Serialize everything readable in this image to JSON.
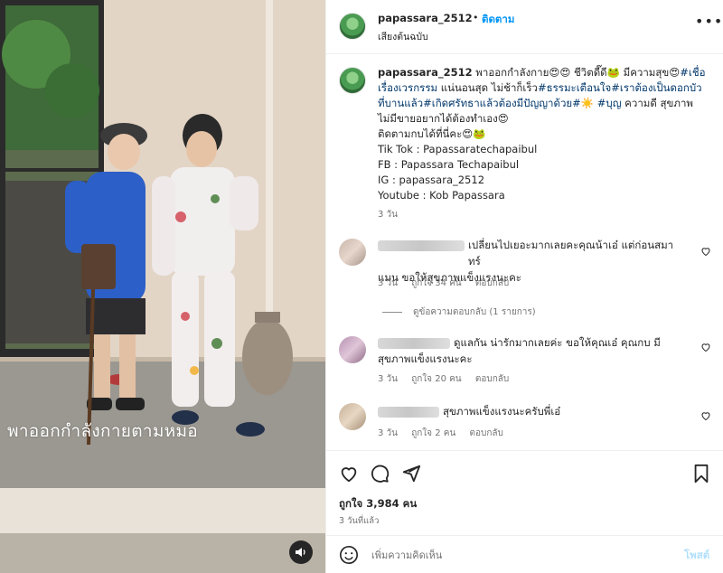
{
  "post": {
    "username": "papassara_2512",
    "separator": "•",
    "follow_label": "ติดตาม",
    "audio_label": "เสียงต้นฉบับ",
    "more_label": "•••",
    "video_overlay_text": "พาออกกำลังกายตามหมอ"
  },
  "caption": {
    "username": "papassara_2512",
    "line1_text": " พาออกกำลังกาย😍😍 ชีวิตดี๊ดี🐸 มีความสุข😍",
    "line1_tag": "#เชื่อ",
    "line2_tag": "เรื่องเวรกรรม",
    "line2_text": " แน่นอนสุด ไม่ช้าก็เร็ว",
    "line2_tag2": "#ธรรมะเตือนใจ",
    "line2_tag3": "#เราต้องเป็นดอกบัว",
    "line3_tag": "ที่บานแล้ว",
    "line3_tag2": "#เกิดศรัทธาแล้วต้องมีปัญญาด้วย",
    "line3_text": "#☀️ ",
    "line3_tag3": "#บุญ",
    "line3_text2": " ความดี สุขภาพ",
    "line4": "ไม่มีขายอยากได้ต้องทำเอง😍",
    "line5": "ติดตามกบได้ที่นี่คะ😍🐸",
    "line6": "Tik Tok : Papassaratechapaibul",
    "line7": "FB : Papassara Techapaibul",
    "line8": "IG : papassara_2512",
    "line9": "Youtube : Kob Papassara",
    "time": "3 วัน"
  },
  "comments": [
    {
      "line1": "เปลี่ยนไปเยอะมากเลยคะคุณน้าเอ๋ แต่ก่อนสมาทร์",
      "line2": "แมน ขอให้สุขภาพแข็งแรงนะคะ",
      "time": "3 วัน",
      "likes": "ถูกใจ 34 คน",
      "reply": "ตอบกลับ"
    },
    {
      "line1": "ดูแลกัน น่ารักมากเลยค่ะ ขอให้คุณเอ๋ คุณกบ มี",
      "line2": "สุขภาพแข็งแรงนะคะ",
      "time": "3 วัน",
      "likes": "ถูกใจ 20 คน",
      "reply": "ตอบกลับ"
    },
    {
      "line1": "สุขภาพแข็งแรงนะครับพี่เอ๋",
      "line2": "",
      "time": "3 วัน",
      "likes": "ถูกใจ 2 คน",
      "reply": "ตอบกลับ"
    }
  ],
  "view_replies": "ดูข้อความตอบกลับ (1 รายการ)",
  "actions": {
    "likes": "ถูกใจ 3,984 คน",
    "ago": "3 วันที่แล้ว"
  },
  "composer": {
    "placeholder": "เพิ่มความคิดเห็น",
    "post_label": "โพสต์"
  },
  "colors": {
    "link": "#0095f6",
    "hashtag": "#00376b",
    "muted": "#737373",
    "post_disabled": "#b2dffc"
  },
  "icons": [
    "sound-icon",
    "heart-icon",
    "comment-icon",
    "share-icon",
    "bookmark-icon",
    "emoji-icon",
    "more-icon"
  ]
}
